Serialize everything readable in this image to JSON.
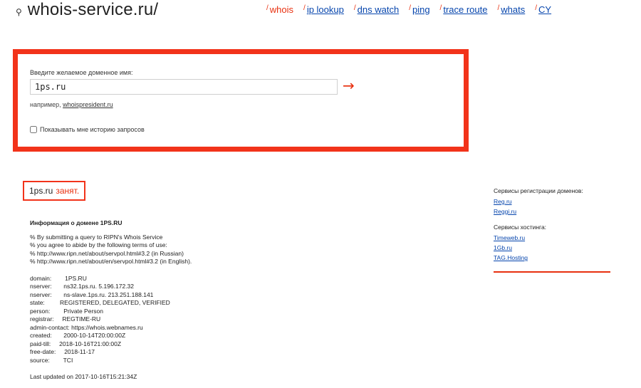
{
  "site": {
    "title": "whois-service.ru/",
    "icon": "key-icon"
  },
  "nav": [
    {
      "label": "whois",
      "active": true
    },
    {
      "label": "ip lookup"
    },
    {
      "label": "dns watch"
    },
    {
      "label": "ping"
    },
    {
      "label": "trace route"
    },
    {
      "label": "whats"
    },
    {
      "label": "CY"
    }
  ],
  "search": {
    "label": "Введите желаемое доменное имя:",
    "value": "1ps.ru",
    "submit_symbol": "→",
    "example_prefix": "например, ",
    "example_link": "whoispresident.ru",
    "history_label": "Показывать мне историю запросов",
    "history_checked": false
  },
  "result": {
    "domain": "1ps.ru",
    "status": "занят."
  },
  "info": {
    "title": "Информация о домене 1PS.RU",
    "terms": [
      "% By submitting a query to RIPN's Whois Service",
      "% you agree to abide by the following terms of use:",
      "% http://www.ripn.net/about/servpol.html#3.2 (in Russian)",
      "% http://www.ripn.net/about/en/servpol.html#3.2 (in English)."
    ],
    "records": [
      "domain:        1PS.RU",
      "nserver:       ns32.1ps.ru. 5.196.172.32",
      "nserver:       ns-slave.1ps.ru. 213.251.188.141",
      "state:         REGISTERED, DELEGATED, VERIFIED",
      "person:        Private Person",
      "registrar:     REGTIME-RU",
      "admin-contact: https://whois.webnames.ru",
      "created:       2000-10-14T20:00:00Z",
      "paid-till:     2018-10-16T21:00:00Z",
      "free-date:     2018-11-17",
      "source:        TCI"
    ],
    "updated": "Last updated on 2017-10-16T15:21:34Z"
  },
  "sidebar": {
    "registrars": {
      "heading": "Сервисы регистрации доменов:",
      "links": [
        "Reg.ru",
        "Reggi.ru"
      ]
    },
    "hosting": {
      "heading": "Сервисы хостинга:",
      "links": [
        "Timeweb.ru",
        "1Gb.ru",
        "TAG.Hosting"
      ]
    }
  },
  "colors": {
    "accent": "#f2331a",
    "link": "#0645ad"
  }
}
